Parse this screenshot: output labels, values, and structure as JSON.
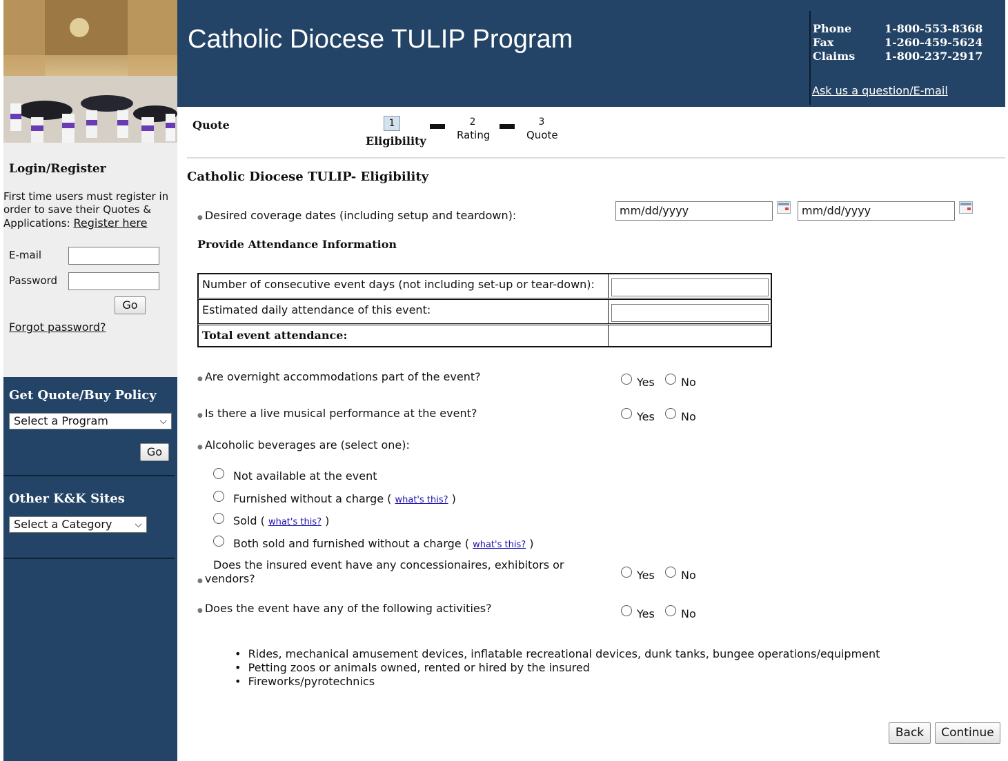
{
  "header": {
    "site_title": "Catholic Diocese TULIP Program",
    "contact": [
      {
        "label": "Phone",
        "value": "1-800-553-8368"
      },
      {
        "label": "Fax",
        "value": "1-260-459-5624"
      },
      {
        "label": "Claims",
        "value": "1-800-237-2917"
      }
    ],
    "ask_link": "Ask us a question/E-mail"
  },
  "sidebar": {
    "login_title": "Login/Register",
    "register_text_1": "First time users must register in",
    "register_text_2": "order to save their Quotes &",
    "register_text_3": "Applications:",
    "register_link": "Register here",
    "email_label": "E-mail",
    "password_label": "Password",
    "go_label": "Go",
    "forgot_link": "Forgot password?",
    "quote_title": "Get Quote/Buy Policy",
    "program_select": "Select a Program",
    "quote_go": "Go",
    "other_title": "Other K&K Sites",
    "category_select": "Select a Category"
  },
  "steps": {
    "label": "Quote",
    "items": [
      {
        "num": "1",
        "label": "Eligibility",
        "active": true
      },
      {
        "num": "2",
        "label": "Rating",
        "active": false
      },
      {
        "num": "3",
        "label": "Quote",
        "active": false
      }
    ]
  },
  "form": {
    "section_title": "Catholic Diocese TULIP- Eligibility",
    "coverage_label": "Desired coverage dates (including setup and teardown):",
    "start_date_placeholder": "mm/dd/yyyy",
    "end_date_placeholder": "mm/dd/yyyy",
    "attendance_title": "Provide Attendance Information",
    "attendance_rows": [
      "Number of consecutive event days (not including set-up or tear-down):",
      "Estimated daily attendance of this event:",
      "Total event attendance:"
    ],
    "yes_label": "Yes",
    "no_label": "No",
    "q_overnight": "Are overnight accommodations part of the event?",
    "q_music": "Is there a live musical performance at the event?",
    "q_alcohol": "Alcoholic beverages are (select one):",
    "alcohol_options": [
      "Not available at the event",
      "Furnished without a charge (",
      "Sold (",
      "Both sold and furnished without a charge ("
    ],
    "whats_this": "what's this?",
    "close_paren": ")",
    "q_vendors_1": "Does the insured event have any concessionaires, exhibitors or",
    "q_vendors_2": "vendors?",
    "q_activities": "Does the event have any of the following activities?",
    "activities": [
      "Rides, mechanical amusement devices, inflatable recreational devices, dunk tanks, bungee operations/equipment",
      "Petting zoos or animals owned, rented or hired by the insured",
      "Fireworks/pyrotechnics"
    ],
    "back_label": "Back",
    "continue_label": "Continue"
  }
}
